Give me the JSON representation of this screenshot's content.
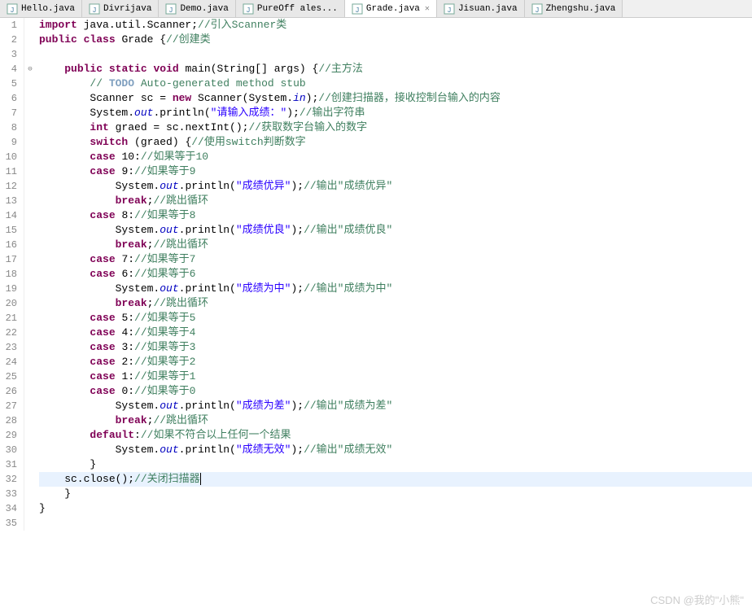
{
  "tabs": [
    {
      "name": "Hello.java",
      "active": false
    },
    {
      "name": "Divrijava",
      "active": false
    },
    {
      "name": "Demo.java",
      "active": false
    },
    {
      "name": "PureOff ales...",
      "active": false
    },
    {
      "name": "Grade.java",
      "active": true
    },
    {
      "name": "Jisuan.java",
      "active": false
    },
    {
      "name": "Zhengshu.java",
      "active": false
    }
  ],
  "lines": {
    "1": {
      "no": "1",
      "t": [
        [
          "kw",
          "import"
        ],
        [
          "normal",
          " java.util.Scanner;"
        ],
        [
          "comment",
          "//引入Scanner类"
        ]
      ]
    },
    "2": {
      "no": "2",
      "t": [
        [
          "kw",
          "public"
        ],
        [
          "normal",
          " "
        ],
        [
          "kw",
          "class"
        ],
        [
          "normal",
          " Grade {"
        ],
        [
          "comment",
          "//创建类"
        ]
      ]
    },
    "3": {
      "no": "3",
      "t": []
    },
    "4": {
      "no": "4",
      "fold": "⊖",
      "t": [
        [
          "normal",
          "    "
        ],
        [
          "kw",
          "public"
        ],
        [
          "normal",
          " "
        ],
        [
          "kw",
          "static"
        ],
        [
          "normal",
          " "
        ],
        [
          "kw",
          "void"
        ],
        [
          "normal",
          " main(String[] args) {"
        ],
        [
          "comment",
          "//主方法"
        ]
      ]
    },
    "5": {
      "no": "5",
      "t": [
        [
          "normal",
          "        "
        ],
        [
          "comment",
          "// "
        ],
        [
          "todo",
          "TODO"
        ],
        [
          "comment",
          " Auto-generated method stub"
        ]
      ]
    },
    "6": {
      "no": "6",
      "t": [
        [
          "normal",
          "        Scanner sc = "
        ],
        [
          "kw",
          "new"
        ],
        [
          "normal",
          " Scanner(System."
        ],
        [
          "static-field",
          "in"
        ],
        [
          "normal",
          ");"
        ],
        [
          "comment",
          "//创建扫描器，接收控制台输入的内容"
        ]
      ]
    },
    "7": {
      "no": "7",
      "t": [
        [
          "normal",
          "        System."
        ],
        [
          "static-field",
          "out"
        ],
        [
          "normal",
          ".println("
        ],
        [
          "string",
          "\"请输入成绩：\""
        ],
        [
          "normal",
          ");"
        ],
        [
          "comment",
          "//输出字符串"
        ]
      ]
    },
    "8": {
      "no": "8",
      "t": [
        [
          "normal",
          "        "
        ],
        [
          "kw",
          "int"
        ],
        [
          "normal",
          " graed = sc.nextInt();"
        ],
        [
          "comment",
          "//获取数字台输入的数字"
        ]
      ]
    },
    "9": {
      "no": "9",
      "t": [
        [
          "normal",
          "        "
        ],
        [
          "kw",
          "switch"
        ],
        [
          "normal",
          " (graed) {"
        ],
        [
          "comment",
          "//使用switch判断数字"
        ]
      ]
    },
    "10": {
      "no": "10",
      "t": [
        [
          "normal",
          "        "
        ],
        [
          "kw",
          "case"
        ],
        [
          "normal",
          " 10:"
        ],
        [
          "comment",
          "//如果等于10"
        ]
      ]
    },
    "11": {
      "no": "11",
      "t": [
        [
          "normal",
          "        "
        ],
        [
          "kw",
          "case"
        ],
        [
          "normal",
          " 9:"
        ],
        [
          "comment",
          "//如果等于9"
        ]
      ]
    },
    "12": {
      "no": "12",
      "t": [
        [
          "normal",
          "            System."
        ],
        [
          "static-field",
          "out"
        ],
        [
          "normal",
          ".println("
        ],
        [
          "string",
          "\"成绩优异\""
        ],
        [
          "normal",
          ");"
        ],
        [
          "comment",
          "//输出\"成绩优异\""
        ]
      ]
    },
    "13": {
      "no": "13",
      "t": [
        [
          "normal",
          "            "
        ],
        [
          "kw",
          "break"
        ],
        [
          "normal",
          ";"
        ],
        [
          "comment",
          "//跳出循环"
        ]
      ]
    },
    "14": {
      "no": "14",
      "t": [
        [
          "normal",
          "        "
        ],
        [
          "kw",
          "case"
        ],
        [
          "normal",
          " 8:"
        ],
        [
          "comment",
          "//如果等于8"
        ]
      ]
    },
    "15": {
      "no": "15",
      "t": [
        [
          "normal",
          "            System."
        ],
        [
          "static-field",
          "out"
        ],
        [
          "normal",
          ".println("
        ],
        [
          "string",
          "\"成绩优良\""
        ],
        [
          "normal",
          ");"
        ],
        [
          "comment",
          "//输出\"成绩优良\""
        ]
      ]
    },
    "16": {
      "no": "16",
      "t": [
        [
          "normal",
          "            "
        ],
        [
          "kw",
          "break"
        ],
        [
          "normal",
          ";"
        ],
        [
          "comment",
          "//跳出循环"
        ]
      ]
    },
    "17": {
      "no": "17",
      "t": [
        [
          "normal",
          "        "
        ],
        [
          "kw",
          "case"
        ],
        [
          "normal",
          " 7:"
        ],
        [
          "comment",
          "//如果等于7"
        ]
      ]
    },
    "18": {
      "no": "18",
      "t": [
        [
          "normal",
          "        "
        ],
        [
          "kw",
          "case"
        ],
        [
          "normal",
          " 6:"
        ],
        [
          "comment",
          "//如果等于6"
        ]
      ]
    },
    "19": {
      "no": "19",
      "t": [
        [
          "normal",
          "            System."
        ],
        [
          "static-field",
          "out"
        ],
        [
          "normal",
          ".println("
        ],
        [
          "string",
          "\"成绩为中\""
        ],
        [
          "normal",
          ");"
        ],
        [
          "comment",
          "//输出\"成绩为中\""
        ]
      ]
    },
    "20": {
      "no": "20",
      "t": [
        [
          "normal",
          "            "
        ],
        [
          "kw",
          "break"
        ],
        [
          "normal",
          ";"
        ],
        [
          "comment",
          "//跳出循环"
        ]
      ]
    },
    "21": {
      "no": "21",
      "t": [
        [
          "normal",
          "        "
        ],
        [
          "kw",
          "case"
        ],
        [
          "normal",
          " 5:"
        ],
        [
          "comment",
          "//如果等于5"
        ]
      ]
    },
    "22": {
      "no": "22",
      "t": [
        [
          "normal",
          "        "
        ],
        [
          "kw",
          "case"
        ],
        [
          "normal",
          " 4:"
        ],
        [
          "comment",
          "//如果等于4"
        ]
      ]
    },
    "23": {
      "no": "23",
      "t": [
        [
          "normal",
          "        "
        ],
        [
          "kw",
          "case"
        ],
        [
          "normal",
          " 3:"
        ],
        [
          "comment",
          "//如果等于3"
        ]
      ]
    },
    "24": {
      "no": "24",
      "t": [
        [
          "normal",
          "        "
        ],
        [
          "kw",
          "case"
        ],
        [
          "normal",
          " 2:"
        ],
        [
          "comment",
          "//如果等于2"
        ]
      ]
    },
    "25": {
      "no": "25",
      "t": [
        [
          "normal",
          "        "
        ],
        [
          "kw",
          "case"
        ],
        [
          "normal",
          " 1:"
        ],
        [
          "comment",
          "//如果等于1"
        ]
      ]
    },
    "26": {
      "no": "26",
      "t": [
        [
          "normal",
          "        "
        ],
        [
          "kw",
          "case"
        ],
        [
          "normal",
          " 0:"
        ],
        [
          "comment",
          "//如果等于0"
        ]
      ]
    },
    "27": {
      "no": "27",
      "t": [
        [
          "normal",
          "            System."
        ],
        [
          "static-field",
          "out"
        ],
        [
          "normal",
          ".println("
        ],
        [
          "string",
          "\"成绩为差\""
        ],
        [
          "normal",
          ");"
        ],
        [
          "comment",
          "//输出\"成绩为差\""
        ]
      ]
    },
    "28": {
      "no": "28",
      "t": [
        [
          "normal",
          "            "
        ],
        [
          "kw",
          "break"
        ],
        [
          "normal",
          ";"
        ],
        [
          "comment",
          "//跳出循环"
        ]
      ]
    },
    "29": {
      "no": "29",
      "t": [
        [
          "normal",
          "        "
        ],
        [
          "kw",
          "default"
        ],
        [
          "normal",
          ":"
        ],
        [
          "comment",
          "//如果不符合以上任何一个结果"
        ]
      ]
    },
    "30": {
      "no": "30",
      "t": [
        [
          "normal",
          "            System."
        ],
        [
          "static-field",
          "out"
        ],
        [
          "normal",
          ".println("
        ],
        [
          "string",
          "\"成绩无效\""
        ],
        [
          "normal",
          ");"
        ],
        [
          "comment",
          "//输出\"成绩无效\""
        ]
      ]
    },
    "31": {
      "no": "31",
      "t": [
        [
          "normal",
          "        }"
        ]
      ]
    },
    "32": {
      "no": "32",
      "hl": true,
      "t": [
        [
          "normal",
          "    sc.close();"
        ],
        [
          "comment",
          "//关闭扫描器"
        ],
        [
          "cursor",
          ""
        ]
      ]
    },
    "33": {
      "no": "33",
      "t": [
        [
          "normal",
          "    }"
        ]
      ]
    },
    "34": {
      "no": "34",
      "t": [
        [
          "normal",
          "}"
        ]
      ]
    },
    "35": {
      "no": "35",
      "t": []
    }
  },
  "watermark": "CSDN @我的\"小熊\""
}
